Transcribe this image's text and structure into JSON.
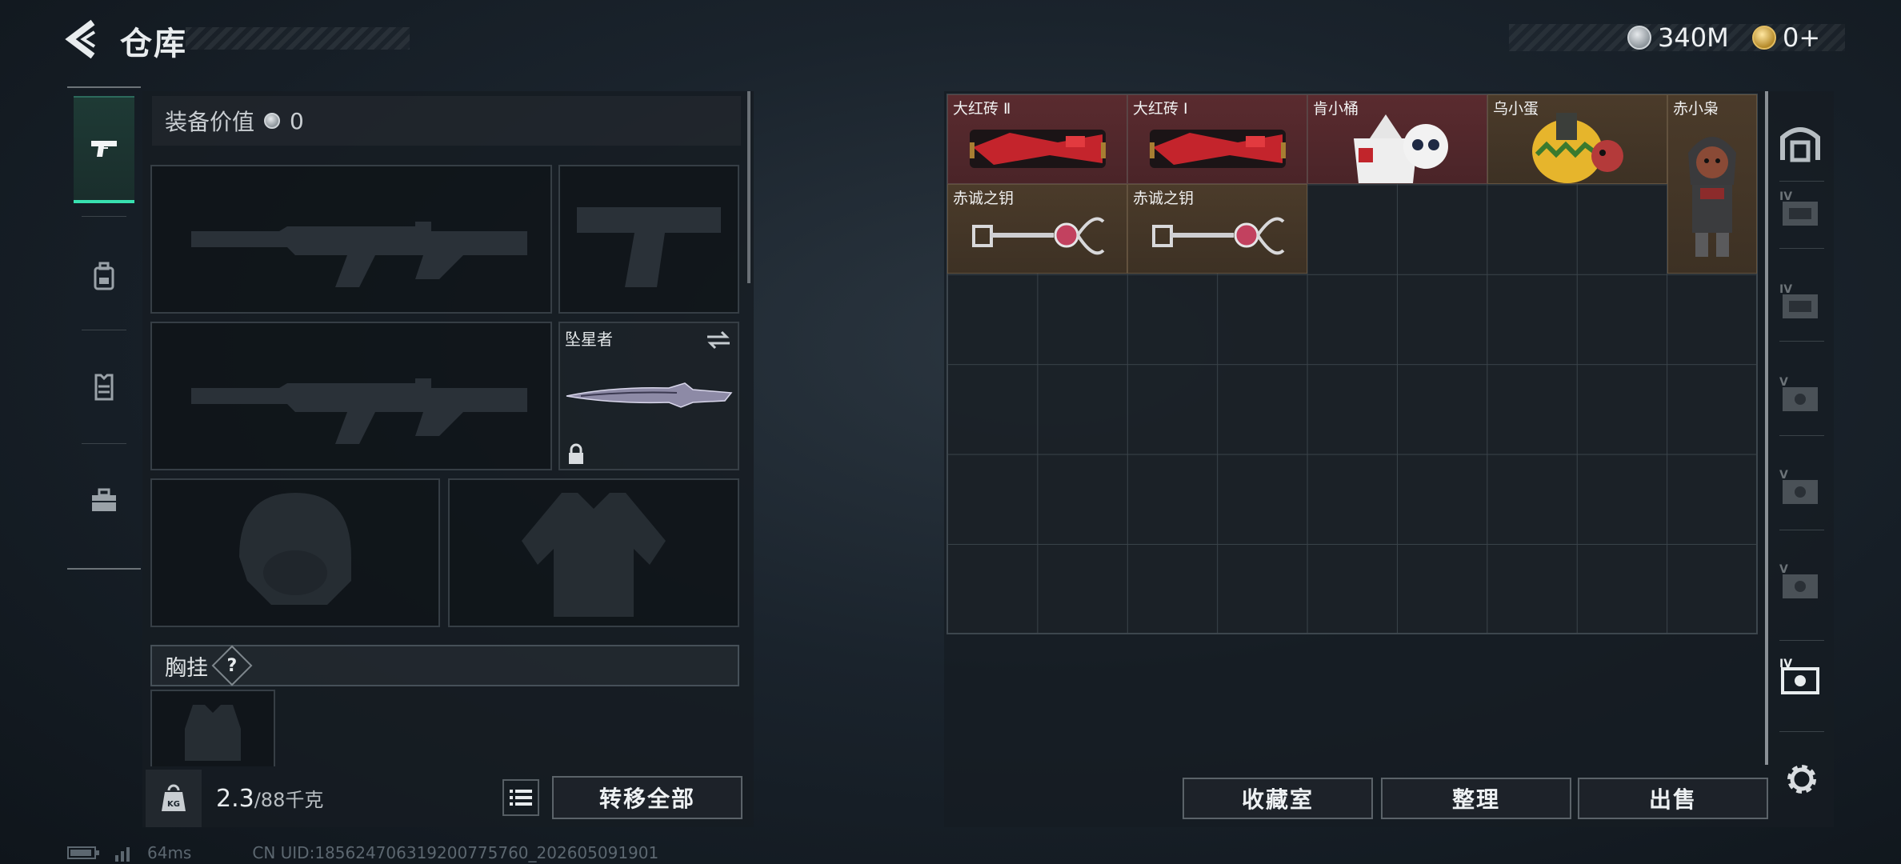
{
  "header": {
    "title": "仓库",
    "currency": [
      {
        "icon": "silver-coin-icon",
        "value": "340M"
      },
      {
        "icon": "gold-coin-icon",
        "value": "0+"
      }
    ]
  },
  "side_tabs": [
    {
      "icon": "pistol-icon",
      "active": true
    },
    {
      "icon": "backpack-icon",
      "active": false
    },
    {
      "icon": "vest-icon",
      "active": false
    },
    {
      "icon": "toolbox-icon",
      "active": false
    }
  ],
  "equipment": {
    "value_label": "装备价值",
    "value": "0",
    "melee_label": "坠星者",
    "chest_label": "胸挂",
    "chest_help": "?"
  },
  "weight": {
    "current": "2.3",
    "max": "/88千克"
  },
  "buttons": {
    "transfer_all": "转移全部",
    "collection": "收藏室",
    "organize": "整理",
    "sell": "出售"
  },
  "storage_items": [
    {
      "label": "大红砖 Ⅱ",
      "rarity": "red"
    },
    {
      "label": "大红砖 Ⅰ",
      "rarity": "red"
    },
    {
      "label": "肯小桶",
      "rarity": "red"
    },
    {
      "label": "乌小蛋",
      "rarity": "gold"
    },
    {
      "label": "赤小枭",
      "rarity": "gold"
    },
    {
      "label": "赤诚之钥",
      "rarity": "gold"
    },
    {
      "label": "赤诚之钥",
      "rarity": "gold"
    }
  ],
  "colors": {
    "accent": "#38e0b0",
    "red_rarity": "#5a2b2f",
    "gold_rarity": "#4b3b2a"
  },
  "footer": {
    "ping": "64ms",
    "uid": "CN UID:185624706319200775760_202605091901"
  }
}
